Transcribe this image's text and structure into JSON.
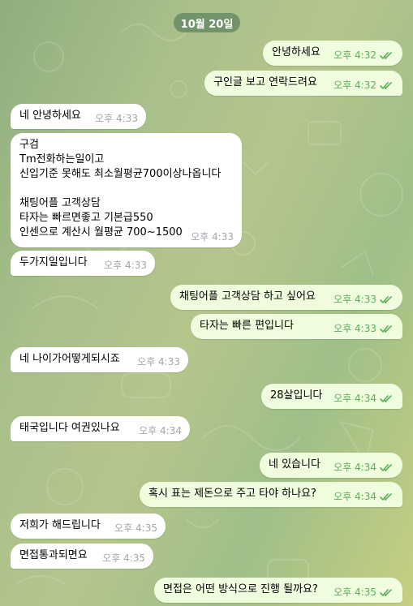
{
  "date_label": "10월 20일",
  "messages": [
    {
      "dir": "out",
      "text": "안녕하세요",
      "time": "오후 4:32",
      "read": true
    },
    {
      "dir": "out",
      "text": "구인글 보고 연락드려요",
      "time": "오후 4:32",
      "read": true
    },
    {
      "dir": "in",
      "text": "네 안녕하세요",
      "time": "오후 4:33"
    },
    {
      "dir": "in",
      "text": "구검\nTm전화하는일이고\n신입기준 못해도 최소월평균700이상나옵니다\n\n채팅어플  고객상담\n타자는 빠르면좋고  기본급550\n인센으로 계산시 월평균 700~1500",
      "time": "오후 4:33"
    },
    {
      "dir": "in",
      "text": "두가지일입니다",
      "time": "오후 4:33"
    },
    {
      "dir": "out",
      "text": "채팅어플 고객상담 하고 싶어요",
      "time": "오후 4:33",
      "read": true
    },
    {
      "dir": "out",
      "text": "타자는 빠른 편입니다",
      "time": "오후 4:33",
      "read": true
    },
    {
      "dir": "in",
      "text": "네 나이가어떻게되시죠",
      "time": "오후 4:33"
    },
    {
      "dir": "out",
      "text": "28살입니다",
      "time": "오후 4:34",
      "read": true
    },
    {
      "dir": "in",
      "text": "태국입니다  여권있나요",
      "time": "오후 4:34"
    },
    {
      "dir": "out",
      "text": "네 있습니다",
      "time": "오후 4:34",
      "read": true
    },
    {
      "dir": "out",
      "text": "혹시 표는 제돈으로 주고 타야 하나요?",
      "time": "오후 4:34",
      "read": true
    },
    {
      "dir": "in",
      "text": "저희가 해드립니다",
      "time": "오후 4:35"
    },
    {
      "dir": "in",
      "text": "면접통과되면요",
      "time": "오후 4:35"
    },
    {
      "dir": "out",
      "text": "면접은 어떤 방식으로 진행 될까요?",
      "time": "오후 4:35",
      "read": true
    }
  ]
}
